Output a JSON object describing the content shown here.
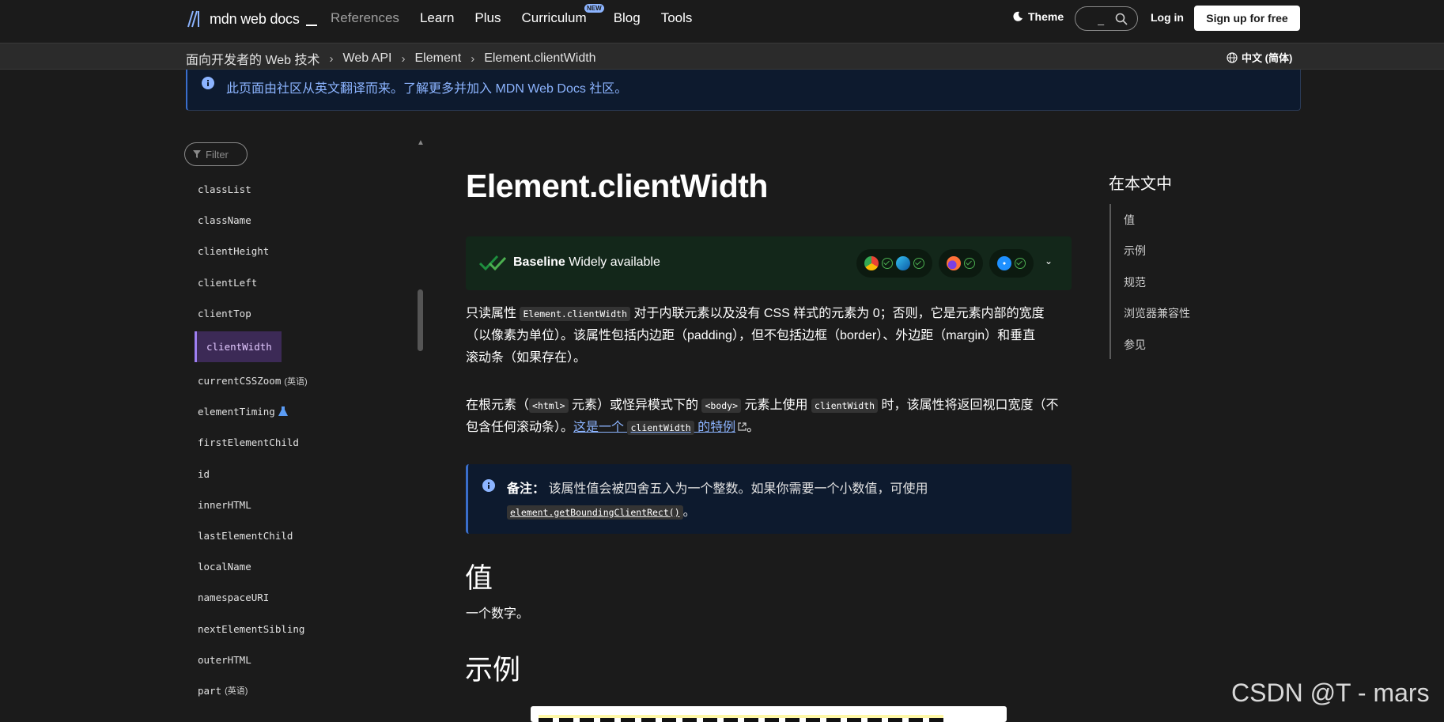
{
  "header": {
    "logo_text": "mdn web docs",
    "nav": [
      "References",
      "Learn",
      "Plus",
      "Curriculum",
      "Blog",
      "Tools"
    ],
    "curriculum_badge": "NEW",
    "theme_label": "Theme",
    "search_hint": "_",
    "login_label": "Log in",
    "signup_label": "Sign up for free"
  },
  "breadcrumb": {
    "items": [
      "面向开发者的 Web 技术",
      "Web API",
      "Element",
      "Element.clientWidth"
    ],
    "language": "中文 (简体)"
  },
  "notice": {
    "text": "此页面由社区从英文翻译而来。了解更多并加入 MDN Web Docs 社区。"
  },
  "sidebar": {
    "filter_placeholder": "Filter",
    "items": [
      {
        "label": "classList",
        "tag": ""
      },
      {
        "label": "className",
        "tag": ""
      },
      {
        "label": "clientHeight",
        "tag": ""
      },
      {
        "label": "clientLeft",
        "tag": ""
      },
      {
        "label": "clientTop",
        "tag": ""
      },
      {
        "label": "clientWidth",
        "tag": ""
      },
      {
        "label": "currentCSSZoom",
        "tag": "(英语)"
      },
      {
        "label": "elementTiming",
        "tag": ""
      },
      {
        "label": "firstElementChild",
        "tag": ""
      },
      {
        "label": "id",
        "tag": ""
      },
      {
        "label": "innerHTML",
        "tag": ""
      },
      {
        "label": "lastElementChild",
        "tag": ""
      },
      {
        "label": "localName",
        "tag": ""
      },
      {
        "label": "namespaceURI",
        "tag": ""
      },
      {
        "label": "nextElementSibling",
        "tag": ""
      },
      {
        "label": "outerHTML",
        "tag": ""
      },
      {
        "label": "part",
        "tag": "(英语)"
      }
    ],
    "active_index": 5
  },
  "article": {
    "title": "Element.clientWidth",
    "baseline_bold": "Baseline",
    "baseline_rest": " Widely available",
    "p1_a": "只读属性 ",
    "p1_code": "Element.clientWidth",
    "p1_b": " 对于内联元素以及没有 CSS 样式的元素为 0；否则，它是元素内部的宽度",
    "p1_line2": "（以像素为单位）。该属性包括内边距（padding），但不包括边框（border）、外边距（margin）和垂直",
    "p1_line3": "滚动条（如果存在）。",
    "p2_a": "在根元素（",
    "p2_code1": "<html>",
    "p2_b": " 元素）或怪异模式下的 ",
    "p2_code2": "<body>",
    "p2_c": " 元素上使用 ",
    "p2_code3": "clientWidth",
    "p2_d": " 时，该属性将返回视口宽度（不",
    "p2_line2_a": "包含任何滚动条）。",
    "p2_link_a": "这是一个 ",
    "p2_link_code": "clientWidth",
    "p2_link_b": " 的特例",
    "p2_end": "。",
    "note_bold": "备注：",
    "note_text": " 该属性值会被四舍五入为一个整数。如果你需要一个小数值，可使用",
    "note_code": "element.getBoundingClientRect()",
    "note_end": "。",
    "h_value": "值",
    "value_text": "一个数字。",
    "h_example": "示例"
  },
  "toc": {
    "title": "在本文中",
    "items": [
      "值",
      "示例",
      "规范",
      "浏览器兼容性",
      "参见"
    ]
  },
  "watermark": "CSDN @T - mars"
}
